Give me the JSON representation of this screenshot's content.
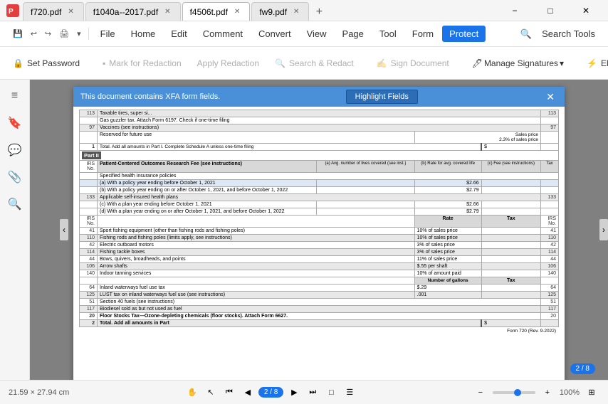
{
  "app": {
    "icon": "pdf-icon"
  },
  "titlebar": {
    "tabs": [
      {
        "id": "tab1",
        "label": "f720.pdf",
        "active": false,
        "closable": true
      },
      {
        "id": "tab2",
        "label": "f1040a--2017.pdf",
        "active": false,
        "closable": true
      },
      {
        "id": "tab3",
        "label": "f4506t.pdf",
        "active": true,
        "closable": true
      },
      {
        "id": "tab4",
        "label": "fw9.pdf",
        "active": false,
        "closable": true
      }
    ],
    "add_tab_label": "+",
    "min_btn": "−",
    "max_btn": "□",
    "close_btn": "✕"
  },
  "menubar": {
    "file": "File",
    "home": "Home",
    "edit": "Edit",
    "comment": "Comment",
    "convert": "Convert",
    "view": "View",
    "page": "Page",
    "tool": "Tool",
    "form": "Form",
    "protect": "Protect",
    "search_tools": "Search Tools"
  },
  "toolbar": {
    "set_password": "Set Password",
    "mark_for_redaction": "Mark for Redaction",
    "apply_redaction": "Apply Redaction",
    "search_redact": "Search & Redact",
    "sign_document": "Sign Document",
    "manage_signatures": "Manage Signatures",
    "electro": "Electro"
  },
  "xfa_bar": {
    "message": "This document contains XFA form fields.",
    "highlight_btn": "Highlight Fields",
    "close": "✕"
  },
  "sidebar": {
    "icons": [
      "≡",
      "🔖",
      "💬",
      "⚙",
      "🔍"
    ]
  },
  "pdf": {
    "title": "Form 720",
    "part2_label": "Part II",
    "rows": [
      {
        "num": "113",
        "desc": "Taxable tires, super si...",
        "shaded": true
      },
      {
        "num": "",
        "desc": "Gas guzzler tax. Attach Form 6197. Check if one-time filing",
        "shaded": false
      },
      {
        "num": "97",
        "desc": "Vaccines (see instructions)",
        "shaded": true
      },
      {
        "num": "",
        "desc": "Reserved for future use",
        "note": "2.3% of sales price",
        "shaded": false
      },
      {
        "num": "1",
        "desc": "Total. Add all amounts in Part I. Complete Schedule A unless one-time filing",
        "shaded": true,
        "bold": true
      },
      {
        "num": "",
        "desc": "Part II",
        "is_part_header": true
      },
      {
        "num": "",
        "desc": "Patient-Centered Outcomes Research Fee (see instructions)",
        "bold": true,
        "shaded": false
      },
      {
        "num": "",
        "desc": "Specified health insurance policies",
        "shaded": false
      },
      {
        "num": "",
        "desc": "(a) With a policy year ending before October 1, 2021",
        "value": "$2.66",
        "shaded": true
      },
      {
        "num": "",
        "desc": "(b) With a policy year ending on or after October 1, 2021, and before October 1, 2022",
        "value": "$2.79",
        "shaded": false
      },
      {
        "num": "133",
        "desc": "Applicable self-insured health plans",
        "shaded": true
      },
      {
        "num": "",
        "desc": "(c) With a plan year ending before October 1, 2021",
        "value": "$2.66",
        "shaded": false
      },
      {
        "num": "",
        "desc": "(d) With a plan year ending on or after October 1, 2021, and before October 1, 2022",
        "value": "$2.79",
        "shaded": false
      },
      {
        "num": "",
        "desc": "Rate",
        "is_header": true
      },
      {
        "num": "41",
        "desc": "Sport fishing equipment (other than fishing rods and fishing poles)",
        "rate": "10% of sales price",
        "shaded": false
      },
      {
        "num": "110",
        "desc": "Fishing rods and fishing poles (limits apply, see instructions)",
        "rate": "10% of sales price",
        "shaded": true
      },
      {
        "num": "42",
        "desc": "Electric outboard motors",
        "rate": "3% of sales price",
        "shaded": false
      },
      {
        "num": "114",
        "desc": "Fishing tackle boxes",
        "rate": "3% of sales price",
        "shaded": true
      },
      {
        "num": "44",
        "desc": "Bows, quivers, broadheads, and points",
        "rate": "11% of sales price",
        "shaded": false
      },
      {
        "num": "106",
        "desc": "Arrow shafts",
        "rate": "$.55 per shaft",
        "shaded": true
      },
      {
        "num": "140",
        "desc": "Indoor tanning services",
        "rate": "10% of amount paid",
        "shaded": false
      },
      {
        "num": "",
        "desc": "Number of gallons",
        "is_header": true
      },
      {
        "num": "64",
        "desc": "Inland waterways fuel use tax",
        "rate": "$.29",
        "shaded": false
      },
      {
        "num": "125",
        "desc": "LUST tax on inland waterways fuel use (see instructions)",
        "rate": ".001",
        "shaded": true
      },
      {
        "num": "51",
        "desc": "Section 40 fuels (see instructions)",
        "shaded": false
      },
      {
        "num": "117",
        "desc": "Biodiesel sold as but not used as fuel",
        "shaded": true
      },
      {
        "num": "20",
        "desc": "Floor Stocks Tax—Ozone-depleting chemicals (floor stocks). Attach Form 6627.",
        "shaded": false,
        "bold": true
      },
      {
        "num": "2",
        "desc": "Total. Add all amounts in Part",
        "shaded": true,
        "bold": true
      }
    ],
    "form_footer": "Form 720 (Rev. 9-2022)"
  },
  "statusbar": {
    "dimensions": "21.59 × 27.94 cm",
    "nav_first": "⏮",
    "nav_prev": "◀",
    "page_current": "2",
    "page_total": "8",
    "page_display": "2 / 8",
    "nav_next": "▶",
    "nav_last": "⏭",
    "single_page": "□",
    "continuous": "☰",
    "zoom_out": "−",
    "zoom_in": "+",
    "zoom_level": "100%",
    "fit_btn": "⊞"
  }
}
